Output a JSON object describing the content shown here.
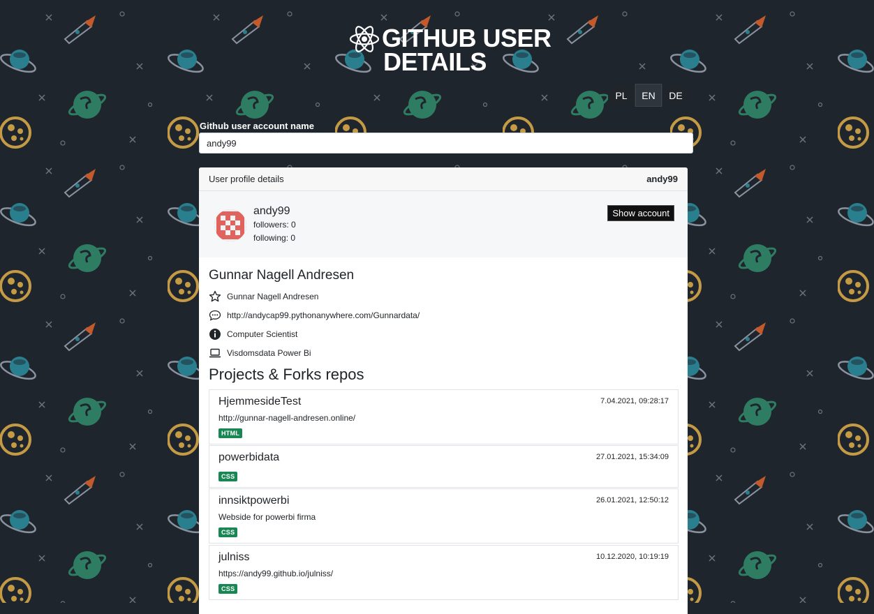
{
  "app": {
    "title_line1": "GITHUB USER",
    "title_line2": "DETAILS"
  },
  "languages": [
    {
      "label": "PL",
      "active": false
    },
    {
      "label": "EN",
      "active": true
    },
    {
      "label": "DE",
      "active": false
    }
  ],
  "search": {
    "label": "Github user account name",
    "value": "andy99"
  },
  "profile": {
    "header_title": "User profile details",
    "header_user": "andy99",
    "login": "andy99",
    "followers": "followers: 0",
    "following": "following: 0",
    "show_account_label": "Show account",
    "full_name": "Gunnar Nagell Andresen",
    "details": [
      {
        "icon": "star-icon",
        "text": "Gunnar Nagell Andresen"
      },
      {
        "icon": "chat-icon",
        "text": "http://andycap99.pythonanywhere.com/Gunnardata/"
      },
      {
        "icon": "info-icon",
        "text": "Computer Scientist"
      },
      {
        "icon": "laptop-icon",
        "text": "Visdomsdata Power Bi"
      }
    ]
  },
  "repos_section": {
    "title": "Projects & Forks repos",
    "repos": [
      {
        "name": "HjemmesideTest",
        "date": "7.04.2021, 09:28:17",
        "description": "http://gunnar-nagell-andresen.online/",
        "language": "HTML"
      },
      {
        "name": "powerbidata",
        "date": "27.01.2021, 15:34:09",
        "description": "",
        "language": "CSS"
      },
      {
        "name": "innsiktpowerbi",
        "date": "26.01.2021, 12:50:12",
        "description": "Webside for powerbi firma",
        "language": "CSS"
      },
      {
        "name": "julniss",
        "date": "10.12.2020, 10:19:19",
        "description": "https://andy99.github.io/julniss/",
        "language": "CSS"
      }
    ]
  },
  "colors": {
    "background": "#1f252d",
    "badge_green": "#198754",
    "planet_green": "#2e7d63",
    "planet_yellow": "#c49a45",
    "rocket_orange": "#c45a2c",
    "ufo_teal": "#2a7f8f"
  }
}
